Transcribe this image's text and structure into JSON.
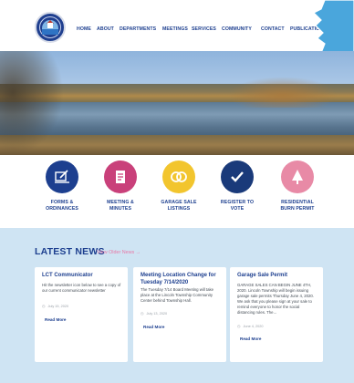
{
  "nav": {
    "items": [
      "HOME",
      "ABOUT",
      "DEPARTMENTS",
      "MEETINGS",
      "SERVICES",
      "COMMUNITY",
      "CONTACT",
      "PUBLICATIONS"
    ]
  },
  "quick_links": [
    {
      "label_1": "FORMS &",
      "label_2": "ORDINANCES",
      "color": "#1d3f8f",
      "icon": "forms-icon"
    },
    {
      "label_1": "MEETING &",
      "label_2": "MINUTES",
      "color": "#c9407a",
      "icon": "document-icon"
    },
    {
      "label_1": "GARAGE SALE",
      "label_2": "LISTINGS",
      "color": "#f2c52e",
      "icon": "coins-icon"
    },
    {
      "label_1": "REGISTER TO",
      "label_2": "VOTE",
      "color": "#1a3a7a",
      "icon": "checkmark-icon"
    },
    {
      "label_1": "RESIDENTIAL",
      "label_2": "BURN PERMIT",
      "color": "#e88aa6",
      "icon": "tree-icon"
    }
  ],
  "news": {
    "title": "LATEST NEWS",
    "more_link": "View Older News →",
    "read_more": "Read More",
    "cards": [
      {
        "title": "LCT Communicator",
        "body": "Hit the newsletter icon below to see a copy of our current communicator newsletter",
        "date": "July 15, 2020"
      },
      {
        "title": "Meeting Location Change for Tuesday 7/14/2020",
        "body": "The Tuesday 7/14 Board Meeting will take place at the Lincoln Township Community Center behind Township Hall.",
        "date": "July 13, 2020"
      },
      {
        "title": "Garage Sale Permit",
        "body": "GARAGE SALES CAN BEGIN JUNE 4TH, 2020. Lincoln Township will begin issuing garage sale permits Thursday June 4, 2020. We ask that you please sign at your sale to remind everyone to honor the social distancing rules. The...",
        "date": "June 4, 2020"
      }
    ]
  },
  "colors": {
    "brand_blue": "#1d3f8f",
    "news_bg": "#cfe4f3",
    "accent_pink": "#e879a7",
    "corner_shape": "#4aa6dc"
  }
}
